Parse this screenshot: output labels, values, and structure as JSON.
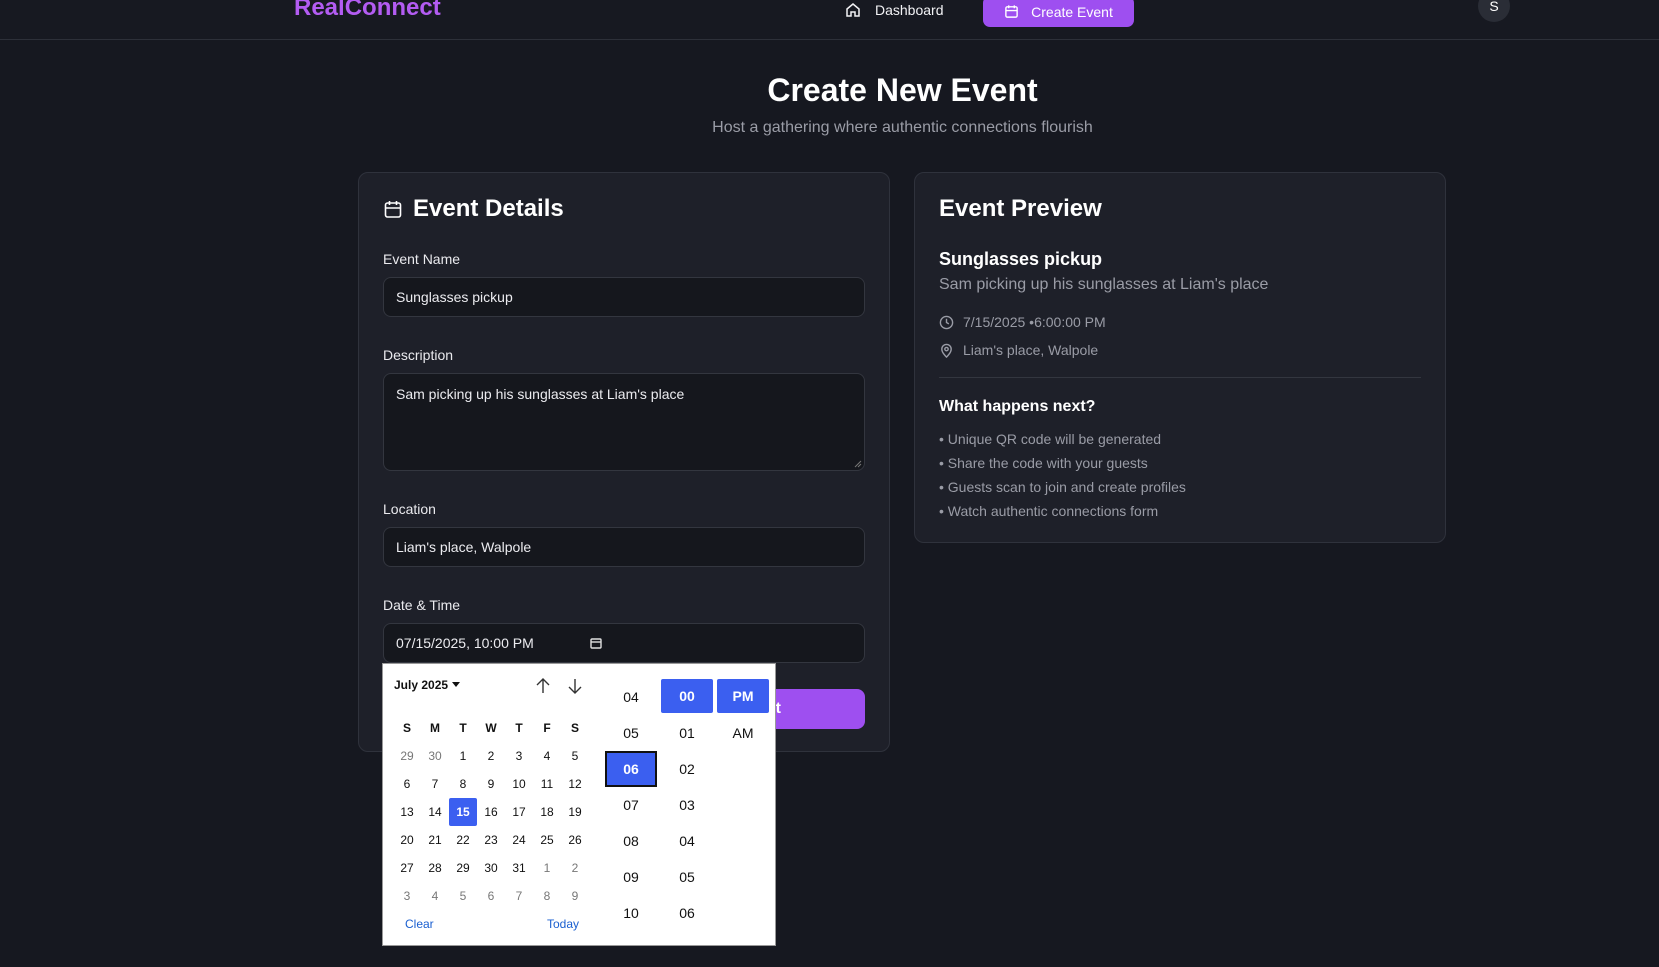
{
  "header": {
    "brand": "RealConnect",
    "nav_dashboard": "Dashboard",
    "nav_create": "Create Event",
    "avatar_initial": "S"
  },
  "page": {
    "title": "Create New Event",
    "subtitle": "Host a gathering where authentic connections flourish"
  },
  "form": {
    "title": "Event Details",
    "name_label": "Event Name",
    "name_value": "Sunglasses pickup",
    "description_label": "Description",
    "description_value": "Sam picking up his sunglasses at Liam's place",
    "location_label": "Location",
    "location_value": "Liam's place, Walpole",
    "datetime_label": "Date & Time",
    "datetime_value": "07/15/2025, 10:00 PM",
    "submit_visible_text": "nt"
  },
  "preview": {
    "title": "Event Preview",
    "event_name": "Sunglasses pickup",
    "event_description": "Sam picking up his sunglasses at Liam's place",
    "datetime": "7/15/2025 •6:00:00 PM",
    "location": "Liam's place, Walpole",
    "next_title": "What happens next?",
    "next_items": [
      "• Unique QR code will be generated",
      "• Share the code with your guests",
      "• Guests scan to join and create profiles",
      "• Watch authentic connections form"
    ]
  },
  "picker": {
    "month_label": "July 2025",
    "weekdays": [
      "S",
      "M",
      "T",
      "W",
      "T",
      "F",
      "S"
    ],
    "weeks": [
      [
        "29",
        "30",
        "1",
        "2",
        "3",
        "4",
        "5"
      ],
      [
        "6",
        "7",
        "8",
        "9",
        "10",
        "11",
        "12"
      ],
      [
        "13",
        "14",
        "15",
        "16",
        "17",
        "18",
        "19"
      ],
      [
        "20",
        "21",
        "22",
        "23",
        "24",
        "25",
        "26"
      ],
      [
        "27",
        "28",
        "29",
        "30",
        "31",
        "1",
        "2"
      ],
      [
        "3",
        "4",
        "5",
        "6",
        "7",
        "8",
        "9"
      ]
    ],
    "selected_day": "15",
    "clear_label": "Clear",
    "today_label": "Today",
    "hours": [
      "04",
      "05",
      "06",
      "07",
      "08",
      "09",
      "10"
    ],
    "selected_hour": "06",
    "minutes": [
      "00",
      "01",
      "02",
      "03",
      "04",
      "05",
      "06"
    ],
    "selected_minute": "00",
    "periods": [
      "PM",
      "AM"
    ],
    "selected_period": "PM"
  },
  "colors": {
    "accent": "#9e4ff0",
    "brand": "#b35cf2",
    "picker_selected": "#3b5ff0",
    "background": "#161820"
  }
}
